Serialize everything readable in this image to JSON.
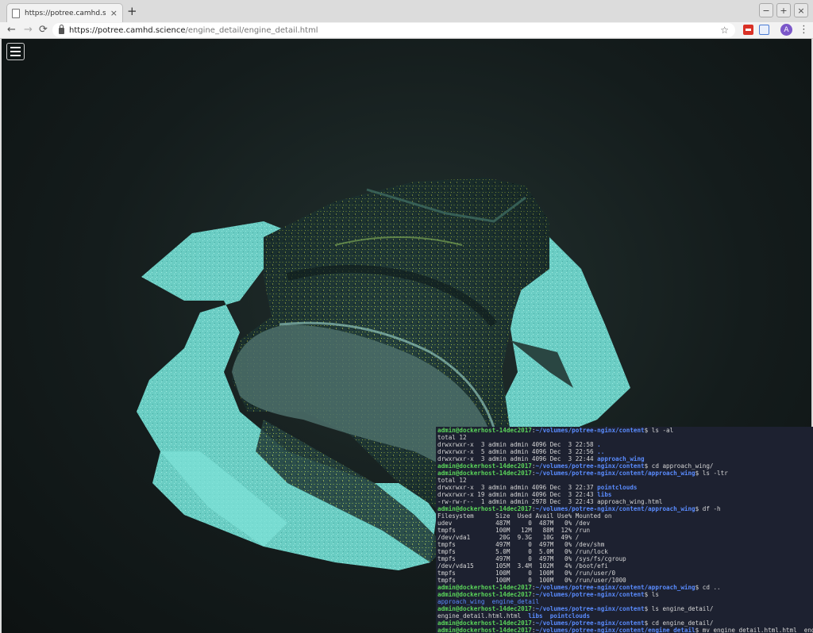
{
  "browser": {
    "tab_title": "https://potree.camhd.science/e",
    "tab_close": "×",
    "new_tab": "+",
    "window_buttons": [
      "−",
      "+",
      "×"
    ],
    "nav": {
      "back": "←",
      "forward": "→",
      "reload": "⟳"
    },
    "url_host": "https://potree.camhd.science",
    "url_path": "/engine_detail/engine_detail.html",
    "star": "☆",
    "avatar_letter": "A",
    "menu": "⋮"
  },
  "viewer": {
    "background": "#141c1c",
    "point_color_primary": "#7fe3d8",
    "point_color_dark": "#1f3a3a"
  },
  "terminal": {
    "lines": [
      {
        "p": "admin@dockerhost-14dec2017",
        "d": "~/volumes/potree-nginx/content",
        "c": " ls -al"
      },
      {
        "t": "total 12"
      },
      {
        "t": "drwxrwxr-x  3 admin admin 4096 Dec  3 22:58 ",
        "b": "."
      },
      {
        "t": "drwxrwxr-x  5 admin admin 4096 Dec  3 22:56 ",
        "b": ".."
      },
      {
        "t": "drwxrwxr-x  3 admin admin 4096 Dec  3 22:44 ",
        "b": "approach_wing"
      },
      {
        "p": "admin@dockerhost-14dec2017",
        "d": "~/volumes/potree-nginx/content",
        "c": " cd approach_wing/"
      },
      {
        "p": "admin@dockerhost-14dec2017",
        "d": "~/volumes/potree-nginx/content/approach_wing",
        "c": " ls -ltr"
      },
      {
        "t": "total 12"
      },
      {
        "t": "drwxrwxr-x  3 admin admin 4096 Dec  3 22:37 ",
        "b": "pointclouds"
      },
      {
        "t": "drwxrwxr-x 19 admin admin 4096 Dec  3 22:43 ",
        "b": "libs"
      },
      {
        "t": "-rw-rw-r--  1 admin admin 2978 Dec  3 22:43 approach_wing.html"
      },
      {
        "p": "admin@dockerhost-14dec2017",
        "d": "~/volumes/potree-nginx/content/approach_wing",
        "c": " df -h"
      },
      {
        "t": "Filesystem      Size  Used Avail Use% Mounted on"
      },
      {
        "t": "udev            487M     0  487M   0% /dev"
      },
      {
        "t": "tmpfs           100M   12M   88M  12% /run"
      },
      {
        "t": "/dev/vda1        20G  9.3G   10G  49% /"
      },
      {
        "t": "tmpfs           497M     0  497M   0% /dev/shm"
      },
      {
        "t": "tmpfs           5.0M     0  5.0M   0% /run/lock"
      },
      {
        "t": "tmpfs           497M     0  497M   0% /sys/fs/cgroup"
      },
      {
        "t": "/dev/vda15      105M  3.4M  102M   4% /boot/efi"
      },
      {
        "t": "tmpfs           100M     0  100M   0% /run/user/0"
      },
      {
        "t": "tmpfs           100M     0  100M   0% /run/user/1000"
      },
      {
        "p": "admin@dockerhost-14dec2017",
        "d": "~/volumes/potree-nginx/content/approach_wing",
        "c": " cd .."
      },
      {
        "p": "admin@dockerhost-14dec2017",
        "d": "~/volumes/potree-nginx/content",
        "c": " ls"
      },
      {
        "bn": "approach_wing  engine_detail"
      },
      {
        "p": "admin@dockerhost-14dec2017",
        "d": "~/volumes/potree-nginx/content",
        "c": " ls engine_detail/"
      },
      {
        "t": "engine_detail.html.html  ",
        "b2": "libs  pointclouds"
      },
      {
        "p": "admin@dockerhost-14dec2017",
        "d": "~/volumes/potree-nginx/content",
        "c": " cd engine_detail/"
      },
      {
        "p": "admin@dockerhost-14dec2017",
        "d": "~/volumes/potree-nginx/content/engine_detail",
        "c": " mv engine_detail.html.html  engine_deta"
      }
    ]
  }
}
